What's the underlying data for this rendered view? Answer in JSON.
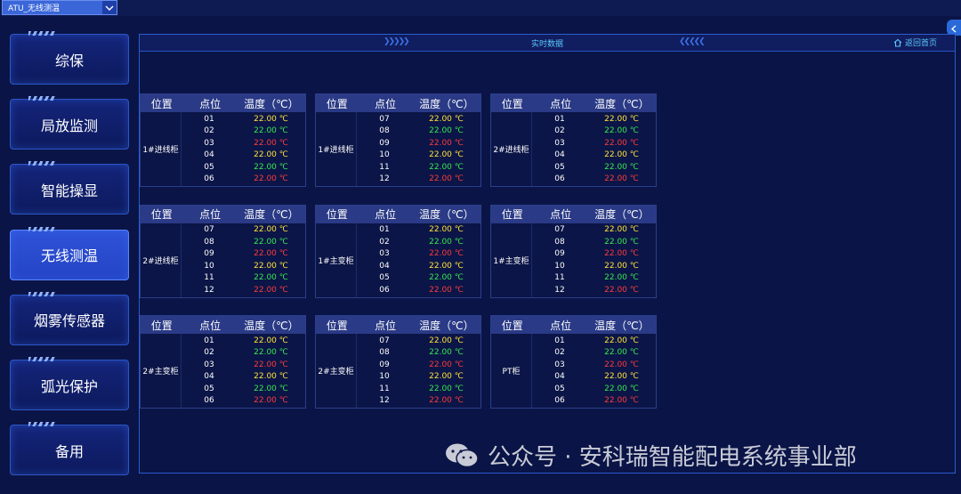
{
  "header": {
    "dropdown_value": "ATU_无线测温"
  },
  "sidebar": {
    "items": [
      {
        "label": "综保",
        "active": false
      },
      {
        "label": "局放监测",
        "active": false
      },
      {
        "label": "智能操显",
        "active": false
      },
      {
        "label": "无线测温",
        "active": true
      },
      {
        "label": "烟雾传感器",
        "active": false
      },
      {
        "label": "弧光保护",
        "active": false
      },
      {
        "label": "备用",
        "active": false
      }
    ]
  },
  "panel": {
    "title": "实时数据",
    "back_label": "返回首页"
  },
  "columns": {
    "location": "位置",
    "point": "点位",
    "temp": "温度（℃）"
  },
  "tables": [
    {
      "location": "1#进线柜",
      "rows": [
        {
          "point": "01",
          "temp": "22.00 ℃",
          "status": "yellow"
        },
        {
          "point": "02",
          "temp": "22.00 ℃",
          "status": "green"
        },
        {
          "point": "03",
          "temp": "22.00 ℃",
          "status": "red"
        },
        {
          "point": "04",
          "temp": "22.00 ℃",
          "status": "yellow"
        },
        {
          "point": "05",
          "temp": "22.00 ℃",
          "status": "green"
        },
        {
          "point": "06",
          "temp": "22.00 ℃",
          "status": "red"
        }
      ]
    },
    {
      "location": "1#进线柜",
      "rows": [
        {
          "point": "07",
          "temp": "22.00 ℃",
          "status": "yellow"
        },
        {
          "point": "08",
          "temp": "22.00 ℃",
          "status": "green"
        },
        {
          "point": "09",
          "temp": "22.00 ℃",
          "status": "red"
        },
        {
          "point": "10",
          "temp": "22.00 ℃",
          "status": "yellow"
        },
        {
          "point": "11",
          "temp": "22.00 ℃",
          "status": "green"
        },
        {
          "point": "12",
          "temp": "22.00 ℃",
          "status": "red"
        }
      ]
    },
    {
      "location": "2#进线柜",
      "rows": [
        {
          "point": "01",
          "temp": "22.00 ℃",
          "status": "yellow"
        },
        {
          "point": "02",
          "temp": "22.00 ℃",
          "status": "green"
        },
        {
          "point": "03",
          "temp": "22.00 ℃",
          "status": "red"
        },
        {
          "point": "04",
          "temp": "22.00 ℃",
          "status": "yellow"
        },
        {
          "point": "05",
          "temp": "22.00 ℃",
          "status": "green"
        },
        {
          "point": "06",
          "temp": "22.00 ℃",
          "status": "red"
        }
      ]
    },
    {
      "location": "2#进线柜",
      "rows": [
        {
          "point": "07",
          "temp": "22.00 ℃",
          "status": "yellow"
        },
        {
          "point": "08",
          "temp": "22.00 ℃",
          "status": "green"
        },
        {
          "point": "09",
          "temp": "22.00 ℃",
          "status": "red"
        },
        {
          "point": "10",
          "temp": "22.00 ℃",
          "status": "yellow"
        },
        {
          "point": "11",
          "temp": "22.00 ℃",
          "status": "green"
        },
        {
          "point": "12",
          "temp": "22.00 ℃",
          "status": "red"
        }
      ]
    },
    {
      "location": "1#主变柜",
      "rows": [
        {
          "point": "01",
          "temp": "22.00 ℃",
          "status": "yellow"
        },
        {
          "point": "02",
          "temp": "22.00 ℃",
          "status": "green"
        },
        {
          "point": "03",
          "temp": "22.00 ℃",
          "status": "red"
        },
        {
          "point": "04",
          "temp": "22.00 ℃",
          "status": "yellow"
        },
        {
          "point": "05",
          "temp": "22.00 ℃",
          "status": "green"
        },
        {
          "point": "06",
          "temp": "22.00 ℃",
          "status": "red"
        }
      ]
    },
    {
      "location": "1#主变柜",
      "rows": [
        {
          "point": "07",
          "temp": "22.00 ℃",
          "status": "yellow"
        },
        {
          "point": "08",
          "temp": "22.00 ℃",
          "status": "green"
        },
        {
          "point": "09",
          "temp": "22.00 ℃",
          "status": "red"
        },
        {
          "point": "10",
          "temp": "22.00 ℃",
          "status": "yellow"
        },
        {
          "point": "11",
          "temp": "22.00 ℃",
          "status": "green"
        },
        {
          "point": "12",
          "temp": "22.00 ℃",
          "status": "red"
        }
      ]
    },
    {
      "location": "2#主变柜",
      "rows": [
        {
          "point": "01",
          "temp": "22.00 ℃",
          "status": "yellow"
        },
        {
          "point": "02",
          "temp": "22.00 ℃",
          "status": "green"
        },
        {
          "point": "03",
          "temp": "22.00 ℃",
          "status": "red"
        },
        {
          "point": "04",
          "temp": "22.00 ℃",
          "status": "yellow"
        },
        {
          "point": "05",
          "temp": "22.00 ℃",
          "status": "green"
        },
        {
          "point": "06",
          "temp": "22.00 ℃",
          "status": "red"
        }
      ]
    },
    {
      "location": "2#主变柜",
      "rows": [
        {
          "point": "07",
          "temp": "22.00 ℃",
          "status": "yellow"
        },
        {
          "point": "08",
          "temp": "22.00 ℃",
          "status": "green"
        },
        {
          "point": "09",
          "temp": "22.00 ℃",
          "status": "red"
        },
        {
          "point": "10",
          "temp": "22.00 ℃",
          "status": "yellow"
        },
        {
          "point": "11",
          "temp": "22.00 ℃",
          "status": "green"
        },
        {
          "point": "12",
          "temp": "22.00 ℃",
          "status": "red"
        }
      ]
    },
    {
      "location": "PT柜",
      "rows": [
        {
          "point": "01",
          "temp": "22.00 ℃",
          "status": "yellow"
        },
        {
          "point": "02",
          "temp": "22.00 ℃",
          "status": "green"
        },
        {
          "point": "03",
          "temp": "22.00 ℃",
          "status": "red"
        },
        {
          "point": "04",
          "temp": "22.00 ℃",
          "status": "yellow"
        },
        {
          "point": "05",
          "temp": "22.00 ℃",
          "status": "green"
        },
        {
          "point": "06",
          "temp": "22.00 ℃",
          "status": "red"
        }
      ]
    }
  ],
  "watermark": {
    "text": "公众号 · 安科瑞智能配电系统事业部",
    "icon": "wechat-icon"
  },
  "colors": {
    "yellow": "#ffe23a",
    "green": "#38e84f",
    "red": "#ff3b3b",
    "accent": "#5cc8ff"
  }
}
